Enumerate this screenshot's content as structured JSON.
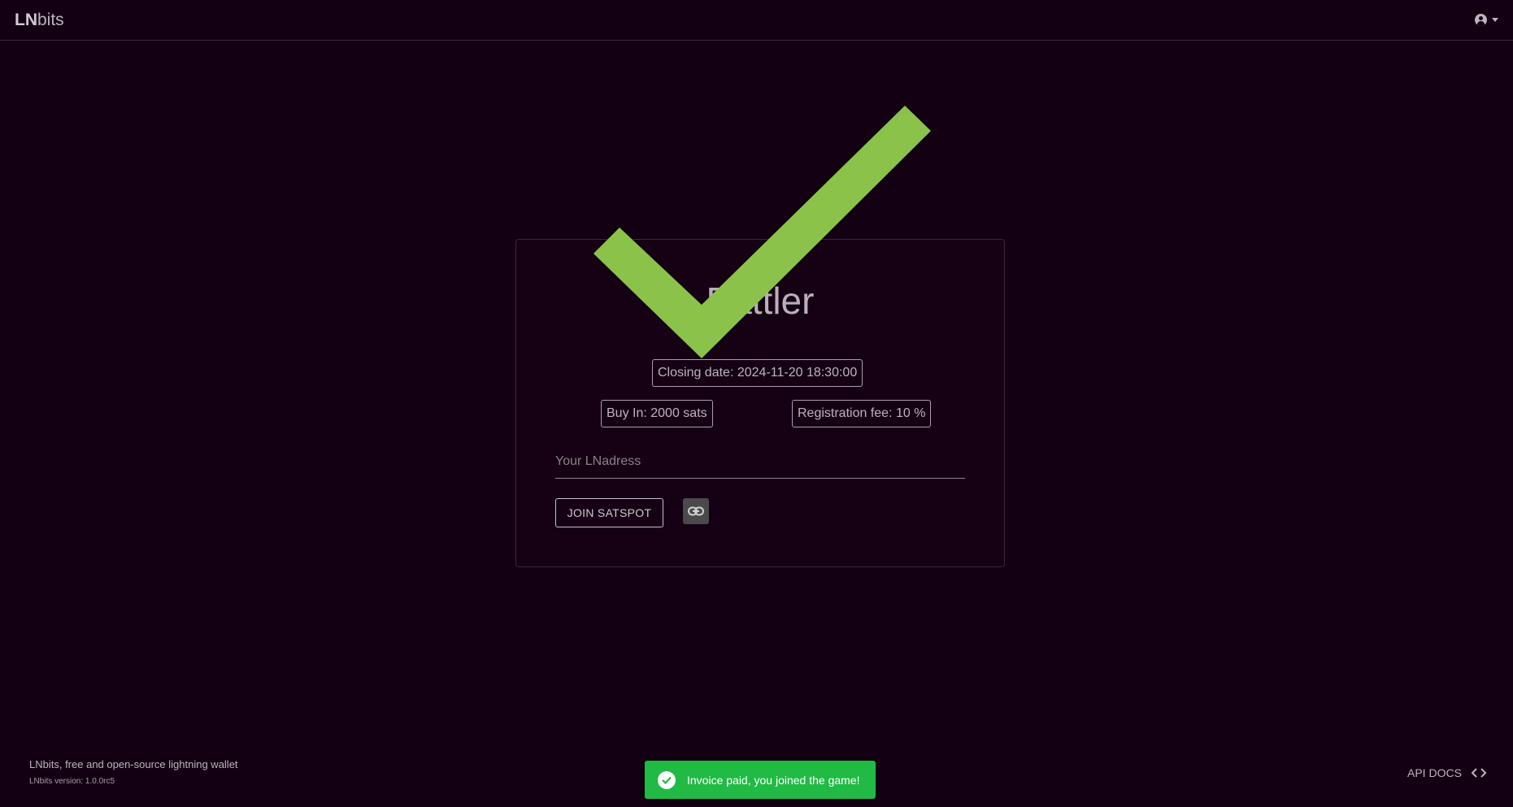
{
  "header": {
    "brand_bold": "LN",
    "brand_rest": "bits",
    "account_icon": "account-circle-icon"
  },
  "card": {
    "title": "Battler",
    "closing_date": "Closing date: 2024-11-20 18:30:00",
    "buy_in": "Buy In: 2000 sats",
    "registration_fee": "Registration fee: 10 %",
    "lnaddress_placeholder": "Your LNadress",
    "lnaddress_value": "",
    "join_button": "JOIN SATSPOT",
    "link_icon": "link-icon"
  },
  "overlay": {
    "icon": "check-icon",
    "color": "#8bc34a"
  },
  "footer": {
    "tagline": "LNbits, free and open-source lightning wallet",
    "version": "LNbits version: 1.0.0rc5",
    "api_docs": "API DOCS"
  },
  "toast": {
    "message": "Invoice paid, you joined the game!",
    "color": "#21ba45"
  }
}
